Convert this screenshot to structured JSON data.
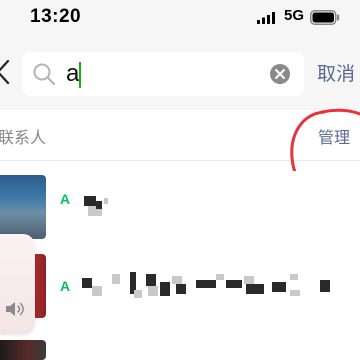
{
  "status_bar": {
    "time": "13:20",
    "network": "5G",
    "signal_icon": "signal-bars-icon",
    "battery_icon": "battery-icon"
  },
  "search": {
    "query": "a",
    "cancel_label": "取消",
    "icons": {
      "back": "chevron-left-icon",
      "search": "search-icon",
      "clear": "clear-circle-icon"
    }
  },
  "section": {
    "title": "联系人",
    "manage_label": "管理"
  },
  "contacts": [
    {
      "highlight": "A"
    },
    {
      "highlight": "A"
    },
    {
      "highlight": ""
    }
  ],
  "overlay": {
    "volume_icon": "speaker-icon"
  },
  "colors": {
    "accent_green": "#07c160",
    "link_blue": "#576b95",
    "annotation_red": "#e8333a",
    "status_bar_bg": "#f6f6f6"
  }
}
